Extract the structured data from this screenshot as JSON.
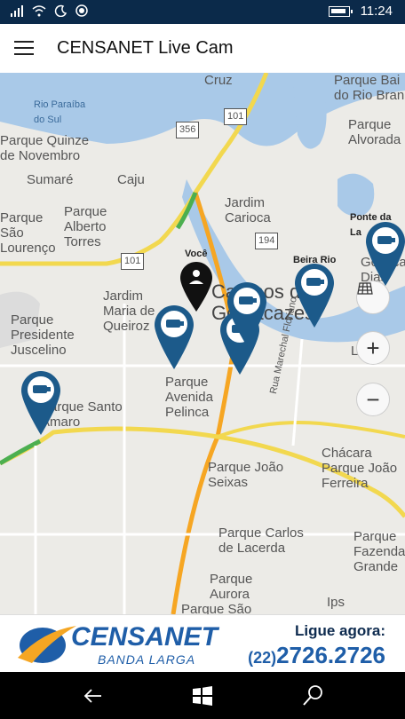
{
  "status_bar": {
    "time": "11:24"
  },
  "app": {
    "title": "CENSANET Live Cam"
  },
  "map": {
    "labels": [
      "Rio Paraíba do Sul",
      "Cruz",
      "Parque Bai do Rio Bran",
      "Parque Quinze de Novembro",
      "Parque Alvorada",
      "Sumaré",
      "Caju",
      "Jardim Carioca",
      "Parque São Lourenço",
      "Parque Alberto Torres",
      "Ponte da La",
      "Beira Rio",
      "Goitaca Dias",
      "Você",
      "Jardim Maria de Queiroz",
      "Campos dos Goytacazes",
      "Parque Presidente Juscelino",
      "Parque Avenida Pelinca",
      "Rua Marechal Floriano",
      "Parque Santo Amaro",
      "Chácara Parque João Ferreira",
      "Parque João Seixas",
      "Parque Carlos de Lacerda",
      "Parque Fazenda Grande",
      "Parque Aurora",
      "Parque São",
      "Ips",
      "Li"
    ],
    "shields": [
      "356",
      "101",
      "194",
      "101"
    ]
  },
  "ad": {
    "brand": "CENSANET",
    "sub": "BANDA LARGA",
    "cta": "Ligue agora:",
    "phone_area": "(22)",
    "phone_number": "2726.2726"
  }
}
